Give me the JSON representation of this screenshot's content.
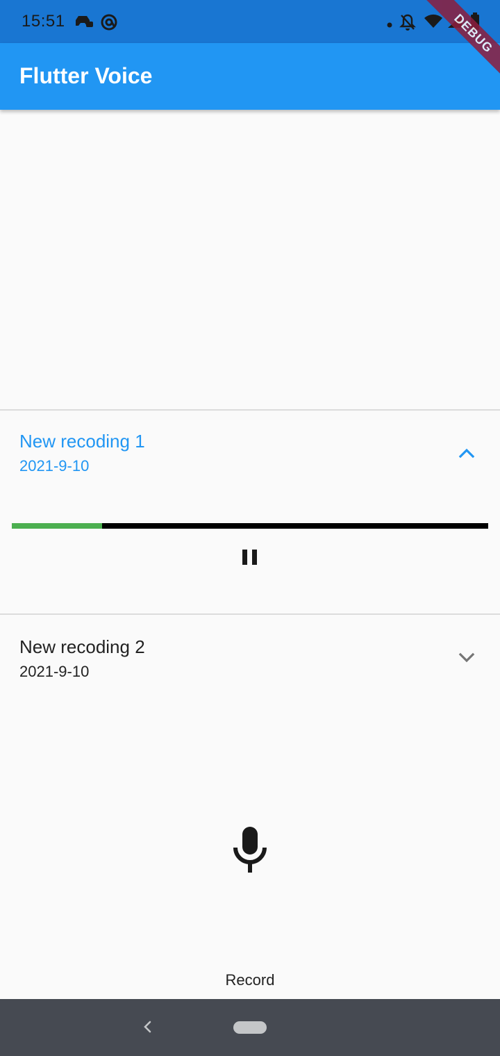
{
  "status_bar": {
    "time": "15:51",
    "icons": [
      "controller-icon",
      "at-sign-icon",
      "dot-icon",
      "bell-off-icon",
      "wifi-icon",
      "signal-icon",
      "battery-icon"
    ],
    "debug_label": "DEBUG"
  },
  "app_bar": {
    "title": "Flutter Voice",
    "color": "#2196f3"
  },
  "recordings": [
    {
      "title": "New recoding 1",
      "date": "2021-9-10",
      "expanded": true,
      "progress": 0.19,
      "control_icon": "pause-icon"
    },
    {
      "title": "New recoding 2",
      "date": "2021-9-10",
      "expanded": false
    }
  ],
  "record": {
    "icon": "microphone-icon",
    "label": "Record"
  },
  "nav_bar": {
    "icons": [
      "back-icon",
      "home-pill-icon"
    ]
  },
  "colors": {
    "accent": "#2196f3",
    "progress_played": "#4caf50",
    "progress_remaining": "#000000",
    "status_bar": "#1976d2",
    "nav_bar": "#464a52"
  }
}
